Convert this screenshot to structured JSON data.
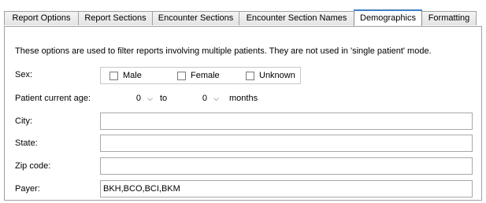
{
  "tabs": [
    {
      "label": "Report Options"
    },
    {
      "label": "Report Sections"
    },
    {
      "label": "Encounter Sections"
    },
    {
      "label": "Encounter Section Names"
    },
    {
      "label": "Demographics",
      "active": true
    },
    {
      "label": "Formatting"
    }
  ],
  "demographics": {
    "info_text": "These options are used to filter reports involving multiple patients. They are not used in 'single patient' mode.",
    "sex_label": "Sex:",
    "sex_options": [
      "Male",
      "Female",
      "Unknown"
    ],
    "age_label": "Patient current age:",
    "age_from": "0",
    "age_to_label": "to",
    "age_to": "0",
    "age_unit": "months",
    "city_label": "City:",
    "city_value": "",
    "state_label": "State:",
    "state_value": "",
    "zip_label": "Zip code:",
    "zip_value": "",
    "payer_label": "Payer:",
    "payer_value": "BKH,BCO,BCI,BKM"
  },
  "colors": {
    "active_tab_accent": "#3c7fc6",
    "border": "#a0a0a0"
  }
}
